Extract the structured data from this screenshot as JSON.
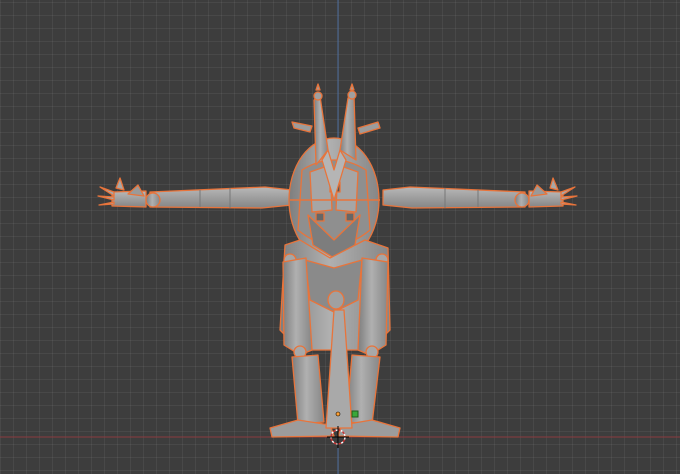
{
  "viewport": {
    "background": "#3d3d3d",
    "grid_color": "#4a4a4a",
    "x_axis_color": "#8c3a40",
    "z_axis_color": "#4a6a9a"
  },
  "model": {
    "body_color": "#9a9a9a",
    "selection_outline_color": "#e8743b",
    "icon": "armored-humanoid-t-pose"
  },
  "origin": {
    "icon": "object-origin-icon",
    "color": "#ffa033"
  },
  "cursor_3d": {
    "icon": "3d-cursor-icon"
  },
  "light": {
    "icon": "light-gizmo-icon",
    "color": "#3aa83a"
  }
}
